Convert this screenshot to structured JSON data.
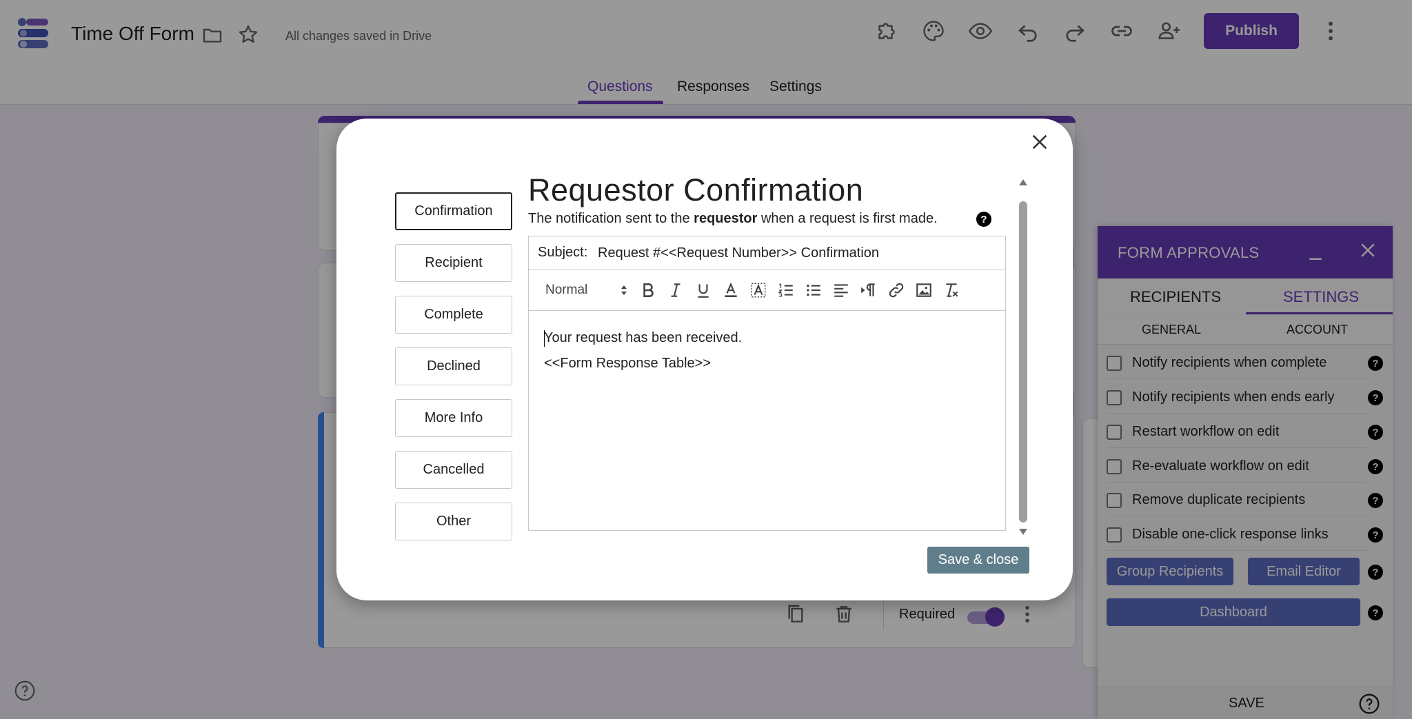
{
  "header": {
    "doc_title": "Time Off Form",
    "save_status": "All changes saved in Drive",
    "publish_label": "Publish",
    "icons": [
      "addons-icon",
      "palette-icon",
      "preview-icon",
      "undo-icon",
      "redo-icon",
      "link-icon",
      "add-collaborator-icon",
      "more-vert-icon"
    ]
  },
  "tabs": [
    {
      "label": "Questions",
      "active": true
    },
    {
      "label": "Responses",
      "active": false
    },
    {
      "label": "Settings",
      "active": false
    }
  ],
  "question_card": {
    "required_label": "Required",
    "required_on": true
  },
  "modal": {
    "title": "Requestor Confirmation",
    "desc_before": "The notification sent to the ",
    "desc_bold": "requestor",
    "desc_after": " when a request is first made.",
    "help_glyph": "?",
    "side_tabs": [
      {
        "label": "Confirmation",
        "active": true
      },
      {
        "label": "Recipient",
        "active": false
      },
      {
        "label": "Complete",
        "active": false
      },
      {
        "label": "Declined",
        "active": false
      },
      {
        "label": "More Info",
        "active": false
      },
      {
        "label": "Cancelled",
        "active": false
      },
      {
        "label": "Other",
        "active": false
      }
    ],
    "subject_label": "Subject:",
    "subject_value": "Request #<<Request Number>> Confirmation",
    "format_select": "Normal",
    "body_lines": [
      "Your request has been received.",
      "<<Form Response Table>>"
    ],
    "save_close_label": "Save & close"
  },
  "side_panel": {
    "title": "FORM APPROVALS",
    "tabs": [
      {
        "label": "RECIPIENTS",
        "active": false
      },
      {
        "label": "SETTINGS",
        "active": true
      }
    ],
    "subtabs": [
      {
        "label": "GENERAL"
      },
      {
        "label": "ACCOUNT"
      }
    ],
    "options": [
      {
        "label": "Notify recipients when complete",
        "checked": false
      },
      {
        "label": "Notify recipients when ends early",
        "checked": false
      },
      {
        "label": "Restart workflow on edit",
        "checked": false
      },
      {
        "label": "Re-evaluate workflow on edit",
        "checked": false
      },
      {
        "label": "Remove duplicate recipients",
        "checked": false
      },
      {
        "label": "Disable one-click response links",
        "checked": false
      }
    ],
    "group_recipients_label": "Group Recipients",
    "email_editor_label": "Email Editor",
    "dashboard_label": "Dashboard",
    "save_label": "SAVE",
    "help_glyph": "?"
  },
  "colors": {
    "brand_purple": "#673ab7",
    "panel_button": "#5c6bc0",
    "save_close": "#607d8b",
    "question_accent": "#4285f4"
  }
}
